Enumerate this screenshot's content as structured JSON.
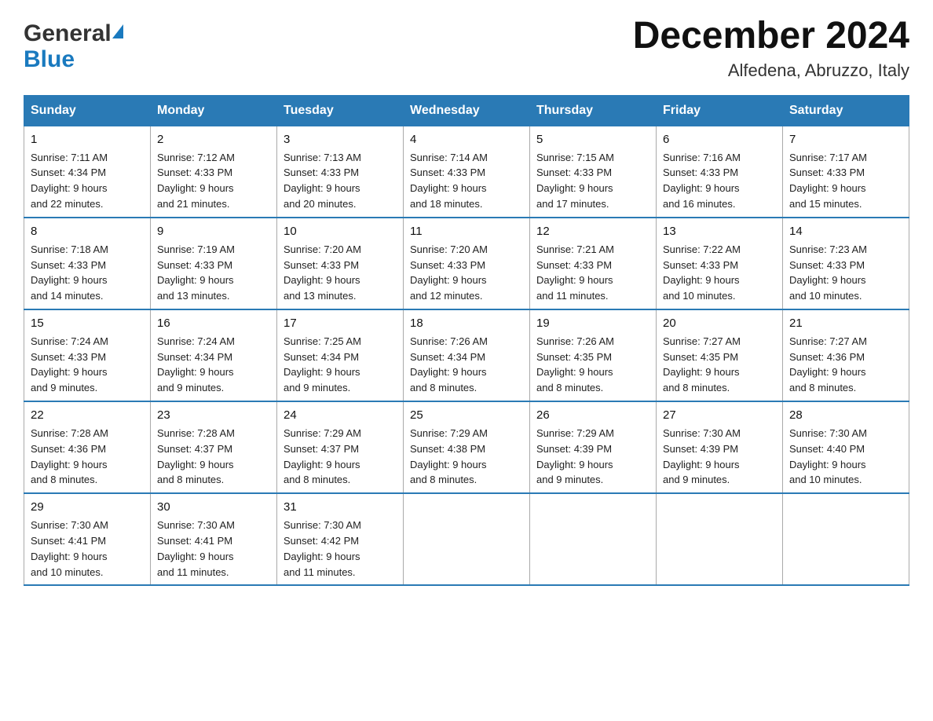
{
  "header": {
    "logo_general": "General",
    "logo_blue": "Blue",
    "month_year": "December 2024",
    "location": "Alfedena, Abruzzo, Italy"
  },
  "days_of_week": [
    "Sunday",
    "Monday",
    "Tuesday",
    "Wednesday",
    "Thursday",
    "Friday",
    "Saturday"
  ],
  "weeks": [
    [
      {
        "day": "1",
        "sunrise": "7:11 AM",
        "sunset": "4:34 PM",
        "daylight": "9 hours and 22 minutes."
      },
      {
        "day": "2",
        "sunrise": "7:12 AM",
        "sunset": "4:33 PM",
        "daylight": "9 hours and 21 minutes."
      },
      {
        "day": "3",
        "sunrise": "7:13 AM",
        "sunset": "4:33 PM",
        "daylight": "9 hours and 20 minutes."
      },
      {
        "day": "4",
        "sunrise": "7:14 AM",
        "sunset": "4:33 PM",
        "daylight": "9 hours and 18 minutes."
      },
      {
        "day": "5",
        "sunrise": "7:15 AM",
        "sunset": "4:33 PM",
        "daylight": "9 hours and 17 minutes."
      },
      {
        "day": "6",
        "sunrise": "7:16 AM",
        "sunset": "4:33 PM",
        "daylight": "9 hours and 16 minutes."
      },
      {
        "day": "7",
        "sunrise": "7:17 AM",
        "sunset": "4:33 PM",
        "daylight": "9 hours and 15 minutes."
      }
    ],
    [
      {
        "day": "8",
        "sunrise": "7:18 AM",
        "sunset": "4:33 PM",
        "daylight": "9 hours and 14 minutes."
      },
      {
        "day": "9",
        "sunrise": "7:19 AM",
        "sunset": "4:33 PM",
        "daylight": "9 hours and 13 minutes."
      },
      {
        "day": "10",
        "sunrise": "7:20 AM",
        "sunset": "4:33 PM",
        "daylight": "9 hours and 13 minutes."
      },
      {
        "day": "11",
        "sunrise": "7:20 AM",
        "sunset": "4:33 PM",
        "daylight": "9 hours and 12 minutes."
      },
      {
        "day": "12",
        "sunrise": "7:21 AM",
        "sunset": "4:33 PM",
        "daylight": "9 hours and 11 minutes."
      },
      {
        "day": "13",
        "sunrise": "7:22 AM",
        "sunset": "4:33 PM",
        "daylight": "9 hours and 10 minutes."
      },
      {
        "day": "14",
        "sunrise": "7:23 AM",
        "sunset": "4:33 PM",
        "daylight": "9 hours and 10 minutes."
      }
    ],
    [
      {
        "day": "15",
        "sunrise": "7:24 AM",
        "sunset": "4:33 PM",
        "daylight": "9 hours and 9 minutes."
      },
      {
        "day": "16",
        "sunrise": "7:24 AM",
        "sunset": "4:34 PM",
        "daylight": "9 hours and 9 minutes."
      },
      {
        "day": "17",
        "sunrise": "7:25 AM",
        "sunset": "4:34 PM",
        "daylight": "9 hours and 9 minutes."
      },
      {
        "day": "18",
        "sunrise": "7:26 AM",
        "sunset": "4:34 PM",
        "daylight": "9 hours and 8 minutes."
      },
      {
        "day": "19",
        "sunrise": "7:26 AM",
        "sunset": "4:35 PM",
        "daylight": "9 hours and 8 minutes."
      },
      {
        "day": "20",
        "sunrise": "7:27 AM",
        "sunset": "4:35 PM",
        "daylight": "9 hours and 8 minutes."
      },
      {
        "day": "21",
        "sunrise": "7:27 AM",
        "sunset": "4:36 PM",
        "daylight": "9 hours and 8 minutes."
      }
    ],
    [
      {
        "day": "22",
        "sunrise": "7:28 AM",
        "sunset": "4:36 PM",
        "daylight": "9 hours and 8 minutes."
      },
      {
        "day": "23",
        "sunrise": "7:28 AM",
        "sunset": "4:37 PM",
        "daylight": "9 hours and 8 minutes."
      },
      {
        "day": "24",
        "sunrise": "7:29 AM",
        "sunset": "4:37 PM",
        "daylight": "9 hours and 8 minutes."
      },
      {
        "day": "25",
        "sunrise": "7:29 AM",
        "sunset": "4:38 PM",
        "daylight": "9 hours and 8 minutes."
      },
      {
        "day": "26",
        "sunrise": "7:29 AM",
        "sunset": "4:39 PM",
        "daylight": "9 hours and 9 minutes."
      },
      {
        "day": "27",
        "sunrise": "7:30 AM",
        "sunset": "4:39 PM",
        "daylight": "9 hours and 9 minutes."
      },
      {
        "day": "28",
        "sunrise": "7:30 AM",
        "sunset": "4:40 PM",
        "daylight": "9 hours and 10 minutes."
      }
    ],
    [
      {
        "day": "29",
        "sunrise": "7:30 AM",
        "sunset": "4:41 PM",
        "daylight": "9 hours and 10 minutes."
      },
      {
        "day": "30",
        "sunrise": "7:30 AM",
        "sunset": "4:41 PM",
        "daylight": "9 hours and 11 minutes."
      },
      {
        "day": "31",
        "sunrise": "7:30 AM",
        "sunset": "4:42 PM",
        "daylight": "9 hours and 11 minutes."
      },
      null,
      null,
      null,
      null
    ]
  ],
  "labels": {
    "sunrise": "Sunrise:",
    "sunset": "Sunset:",
    "daylight": "Daylight:"
  }
}
